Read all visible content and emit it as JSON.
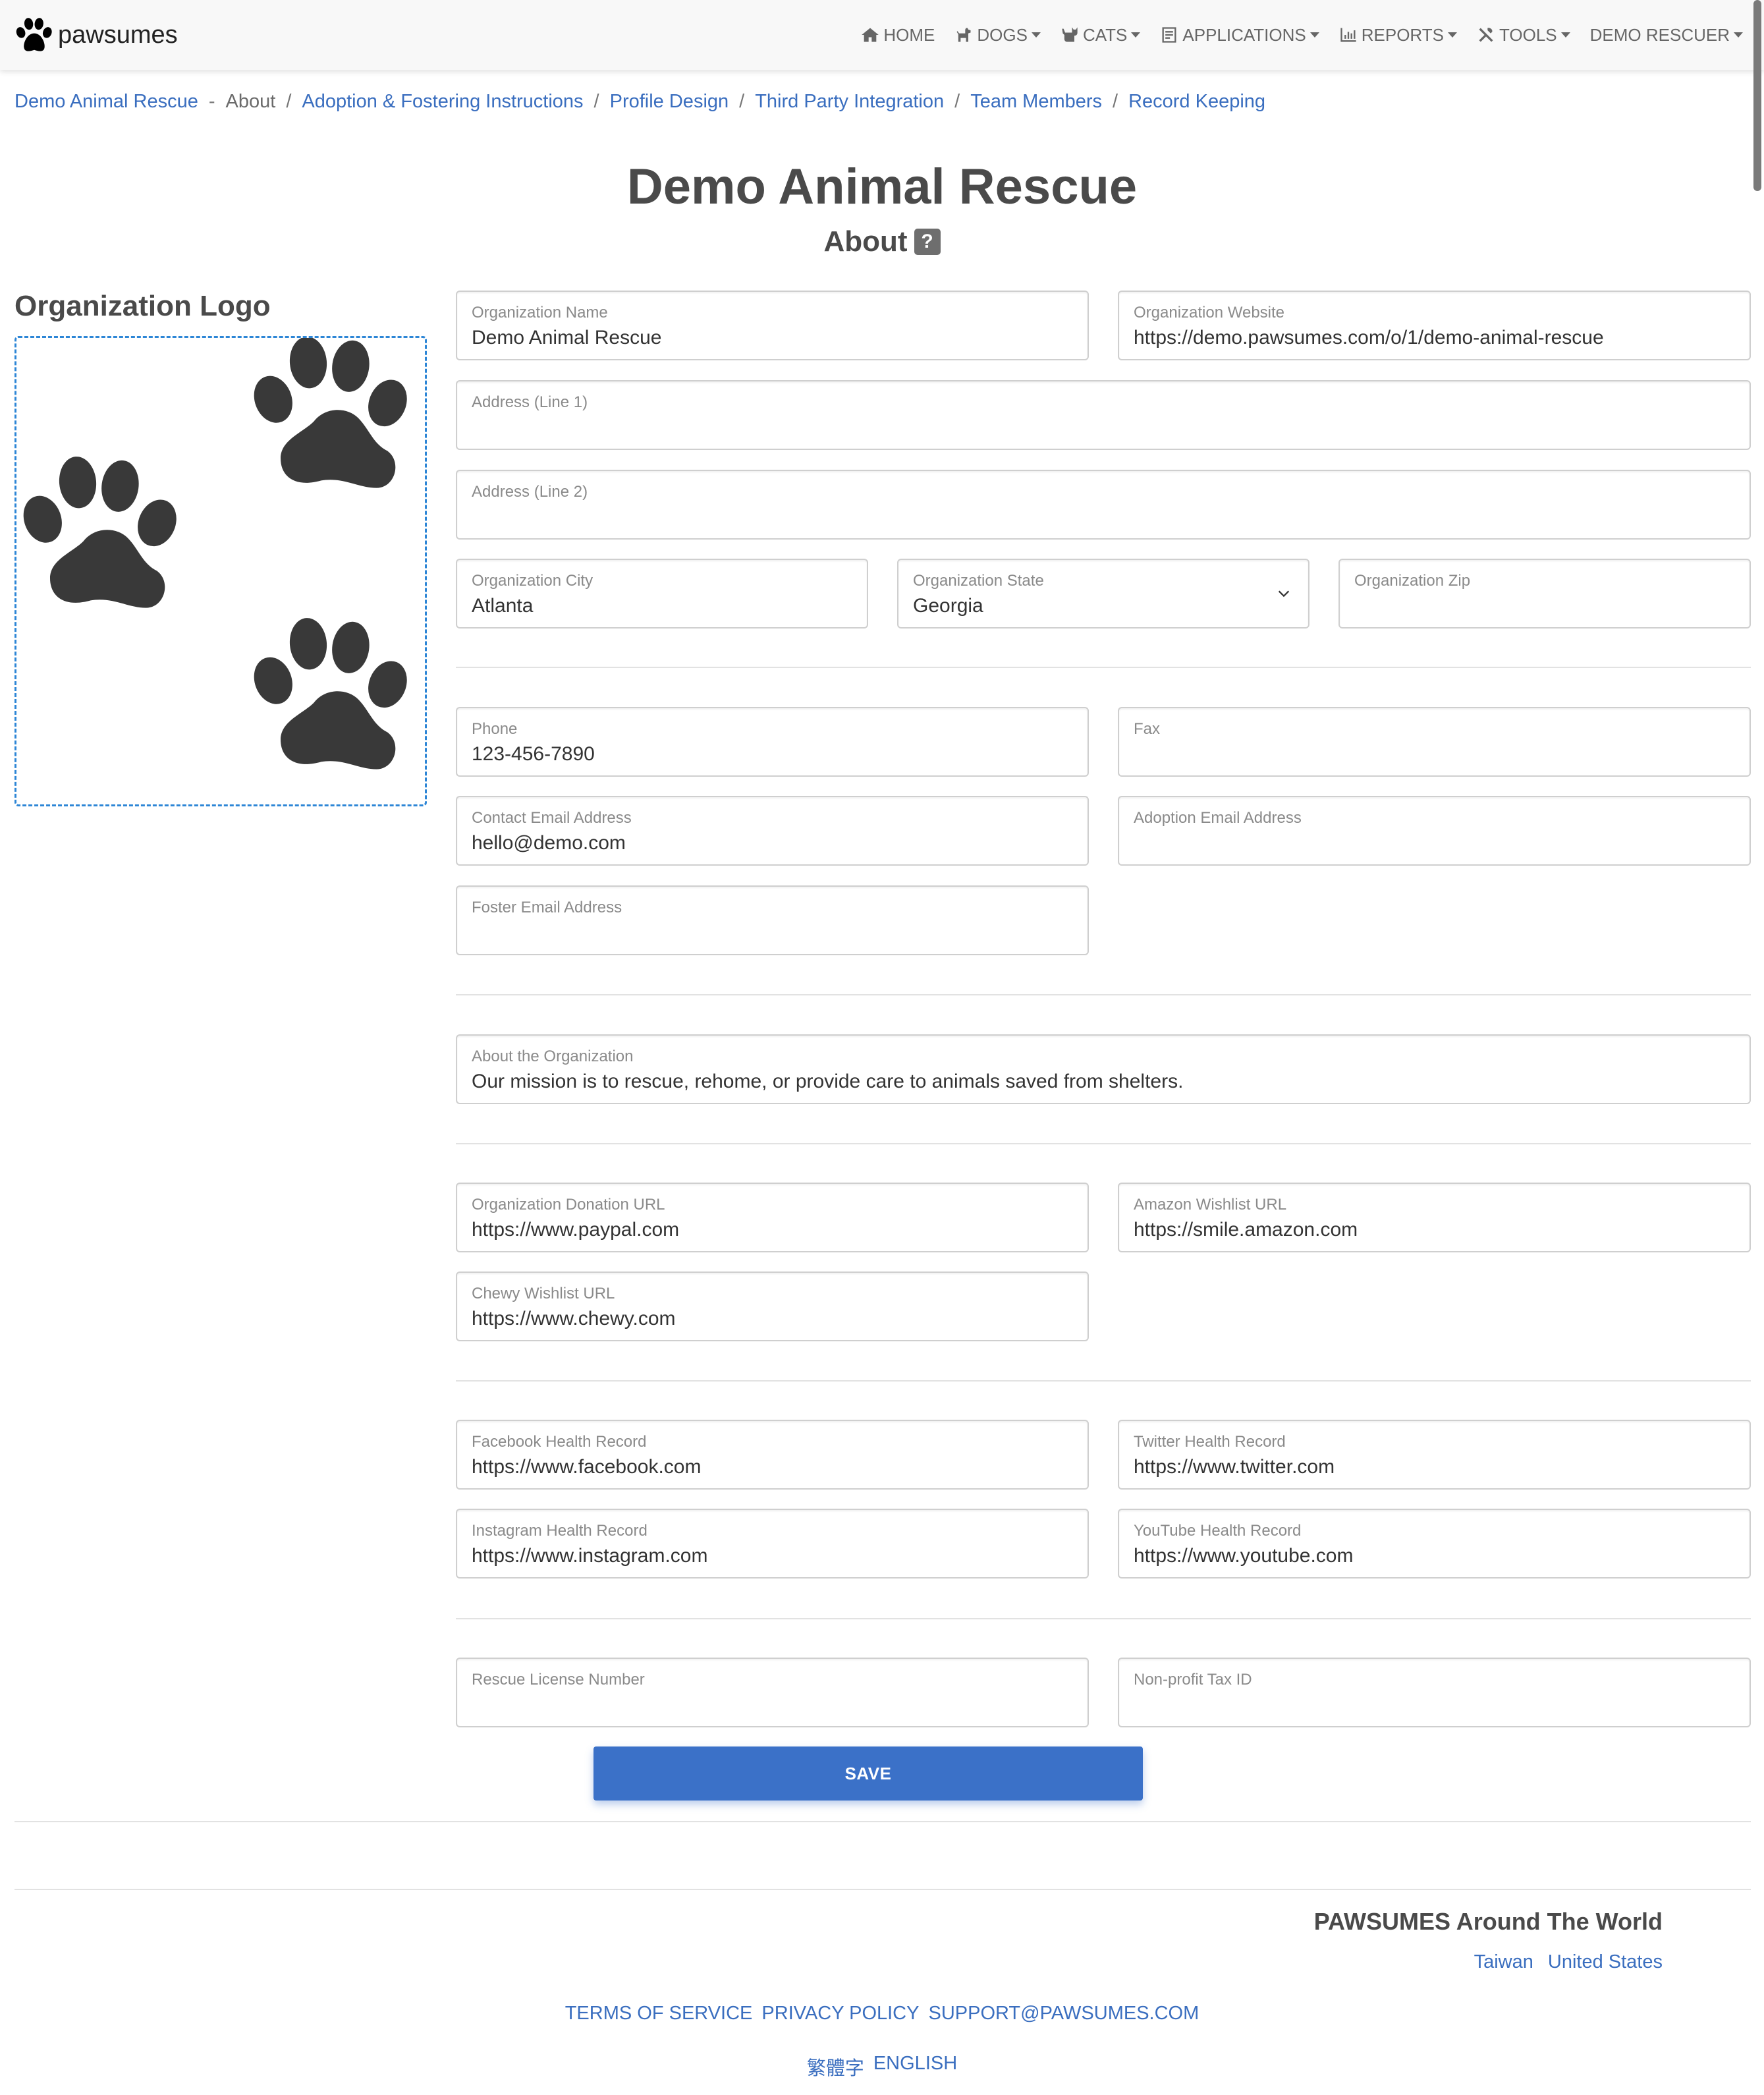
{
  "navbar": {
    "brand": "pawsumes",
    "items": [
      {
        "label": "HOME",
        "icon": "home-icon",
        "dropdown": false
      },
      {
        "label": "DOGS",
        "icon": "dog-icon",
        "dropdown": true
      },
      {
        "label": "CATS",
        "icon": "cat-icon",
        "dropdown": true
      },
      {
        "label": "APPLICATIONS",
        "icon": "clipboard-icon",
        "dropdown": true
      },
      {
        "label": "REPORTS",
        "icon": "bar-chart-icon",
        "dropdown": true
      },
      {
        "label": "TOOLS",
        "icon": "tools-icon",
        "dropdown": true
      },
      {
        "label": "DEMO RESCUER",
        "icon": "",
        "dropdown": true
      }
    ]
  },
  "breadcrumb": {
    "root": "Demo Animal Rescue",
    "root_sep": "-",
    "current": "About",
    "sep": "/",
    "links": [
      "Adoption & Fostering Instructions",
      "Profile Design",
      "Third Party Integration",
      "Team Members",
      "Record Keeping"
    ]
  },
  "page": {
    "title": "Demo Animal Rescue",
    "subtitle": "About",
    "help_icon": "?"
  },
  "logo": {
    "heading": "Organization Logo"
  },
  "form": {
    "org_name": {
      "label": "Organization Name",
      "value": "Demo Animal Rescue"
    },
    "org_website": {
      "label": "Organization Website",
      "value": "https://demo.pawsumes.com/o/1/demo-animal-rescue"
    },
    "address1": {
      "label": "Address (Line 1)",
      "value": ""
    },
    "address2": {
      "label": "Address (Line 2)",
      "value": ""
    },
    "city": {
      "label": "Organization City",
      "value": "Atlanta"
    },
    "state": {
      "label": "Organization State",
      "value": "Georgia"
    },
    "zip": {
      "label": "Organization Zip",
      "value": ""
    },
    "phone": {
      "label": "Phone",
      "value": "123-456-7890"
    },
    "fax": {
      "label": "Fax",
      "value": ""
    },
    "contact_email": {
      "label": "Contact Email Address",
      "value": "hello@demo.com"
    },
    "adoption_email": {
      "label": "Adoption Email Address",
      "value": ""
    },
    "foster_email": {
      "label": "Foster Email Address",
      "value": ""
    },
    "about": {
      "label": "About the Organization",
      "value": "Our mission is to rescue, rehome, or provide care to animals saved from shelters."
    },
    "donation_url": {
      "label": "Organization Donation URL",
      "value": "https://www.paypal.com"
    },
    "amazon_url": {
      "label": "Amazon Wishlist URL",
      "value": "https://smile.amazon.com"
    },
    "chewy_url": {
      "label": "Chewy Wishlist URL",
      "value": "https://www.chewy.com"
    },
    "facebook": {
      "label": "Facebook Health Record",
      "value": "https://www.facebook.com"
    },
    "twitter": {
      "label": "Twitter Health Record",
      "value": "https://www.twitter.com"
    },
    "instagram": {
      "label": "Instagram Health Record",
      "value": "https://www.instagram.com"
    },
    "youtube": {
      "label": "YouTube Health Record",
      "value": "https://www.youtube.com"
    },
    "license": {
      "label": "Rescue License Number",
      "value": ""
    },
    "tax_id": {
      "label": "Non-profit Tax ID",
      "value": ""
    },
    "save_label": "SAVE"
  },
  "footer": {
    "heading": "PAWSUMES Around The World",
    "countries": [
      "Taiwan",
      "United States"
    ],
    "links": [
      "TERMS OF SERVICE",
      "PRIVACY POLICY",
      "SUPPORT@PAWSUMES.COM"
    ],
    "languages": [
      "繁體字",
      "ENGLISH"
    ]
  },
  "colors": {
    "link": "#3a6ebf",
    "primary_button": "#3b71c8",
    "logo_border": "#2d86d6"
  }
}
